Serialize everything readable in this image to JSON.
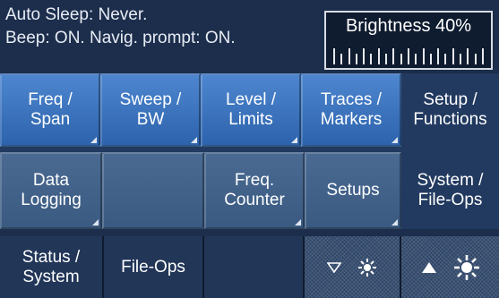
{
  "status": {
    "line1": "Auto Sleep: Never.",
    "line2": "Beep: ON. Navig. prompt: ON."
  },
  "brightness": {
    "label": "Brightness 40%",
    "level_percent": 40
  },
  "tabs": [
    {
      "line1": "Freq /",
      "line2": "Span"
    },
    {
      "line1": "Sweep /",
      "line2": "BW"
    },
    {
      "line1": "Level /",
      "line2": "Limits"
    },
    {
      "line1": "Traces /",
      "line2": "Markers"
    },
    {
      "line1": "Setup /",
      "line2": "Functions"
    }
  ],
  "functions": {
    "data_logging": {
      "line1": "Data",
      "line2": "Logging"
    },
    "blank": "",
    "freq_counter": {
      "line1": "Freq.",
      "line2": "Counter"
    },
    "setups": "Setups",
    "system_file_ops": {
      "line1": "System /",
      "line2": "File-Ops"
    }
  },
  "bottom_bar": {
    "status_system": {
      "line1": "Status /",
      "line2": "System"
    },
    "file_ops": "File-Ops",
    "brightness_down_icon": "brightness-down-icon",
    "brightness_up_icon": "brightness-up-icon"
  },
  "colors": {
    "background": "#1c2e4c",
    "tab_blue": "#3a72bd",
    "active_tab": "#223a60"
  }
}
